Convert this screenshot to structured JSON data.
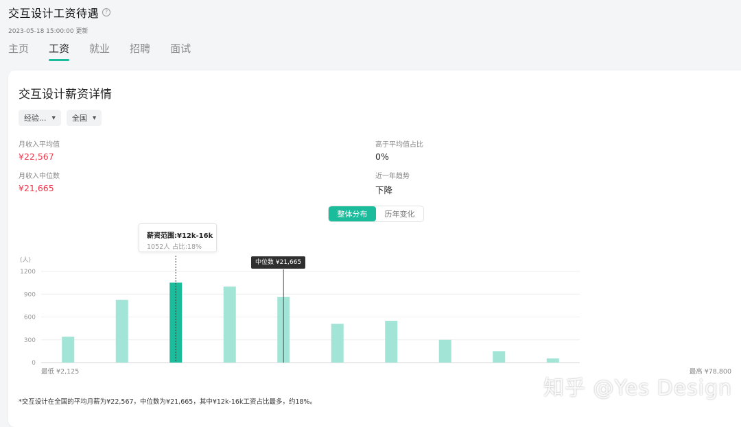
{
  "header": {
    "title": "交互设计工资待遇",
    "help_icon": "question-circle-icon",
    "updated": "2023-05-18 15:00:00 更新"
  },
  "tabs": [
    {
      "label": "主页",
      "active": false
    },
    {
      "label": "工资",
      "active": true
    },
    {
      "label": "就业",
      "active": false
    },
    {
      "label": "招聘",
      "active": false
    },
    {
      "label": "面试",
      "active": false
    }
  ],
  "card": {
    "title": "交互设计薪资详情",
    "filters": [
      {
        "label": "经验...",
        "icon": "caret-down-icon"
      },
      {
        "label": "全国",
        "icon": "caret-down-icon"
      }
    ],
    "stats": {
      "avg_label": "月收入平均值",
      "avg_value": "¥22,567",
      "median_label": "月收入中位数",
      "median_value": "¥21,665",
      "above_avg_label": "高于平均值占比",
      "above_avg_value": "0%",
      "trend_label": "近一年趋势",
      "trend_value": "下降"
    },
    "segment": {
      "options": [
        "整体分布",
        "历年变化"
      ],
      "active_index": 0
    },
    "tooltip": {
      "title": "薪资范围:¥12k-16k",
      "subtitle": "1052人  占比:18%"
    },
    "median_tag": "中位数 ¥21,665",
    "footnote": "*交互设计在全国的平均月薪为¥22,567，中位数为¥21,665，其中¥12k-16k工资占比最多，约18%。"
  },
  "colors": {
    "accent": "#1abc9c",
    "bar": "#a2e5d6",
    "highlight_bar": "#1abc9c",
    "red": "#e8394d"
  },
  "chart_data": {
    "type": "bar",
    "ylabel": "(人)",
    "yticks": [
      0,
      300,
      600,
      900,
      1200
    ],
    "ylim": [
      0,
      1200
    ],
    "values": [
      340,
      825,
      1052,
      1000,
      865,
      510,
      550,
      300,
      150,
      55
    ],
    "highlight_index": 2,
    "median_position": 4.0,
    "x_min_label": "最低 ¥2,125",
    "x_max_label": "最高 ¥78,800",
    "grid": true
  },
  "watermark": "知乎 @Yes Design"
}
